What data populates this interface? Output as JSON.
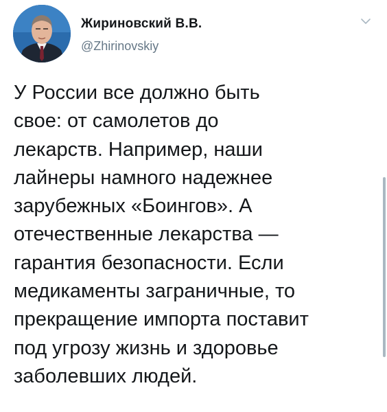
{
  "author": {
    "display_name": "Жириновский В.В.",
    "handle": "@Zhirinovskiy",
    "avatar_icon": "profile-photo"
  },
  "menu": {
    "icon": "chevron-down-icon"
  },
  "tweet": {
    "lines": [
      "У России все должно быть",
      "свое: от самолетов до",
      "лекарств. Например, наши",
      "лайнеры намного надежнее",
      "зарубежных «Боингов». А",
      "отечественные лекарства —",
      "гарантия безопасности. Если",
      "медикаменты заграничные, то",
      "прекращение импорта поставит",
      "под угрозу жизнь и здоровье",
      "заболевших людей."
    ]
  },
  "colors": {
    "text": "#14171a",
    "secondary": "#657786",
    "scrollbar": "#aab8c2"
  }
}
